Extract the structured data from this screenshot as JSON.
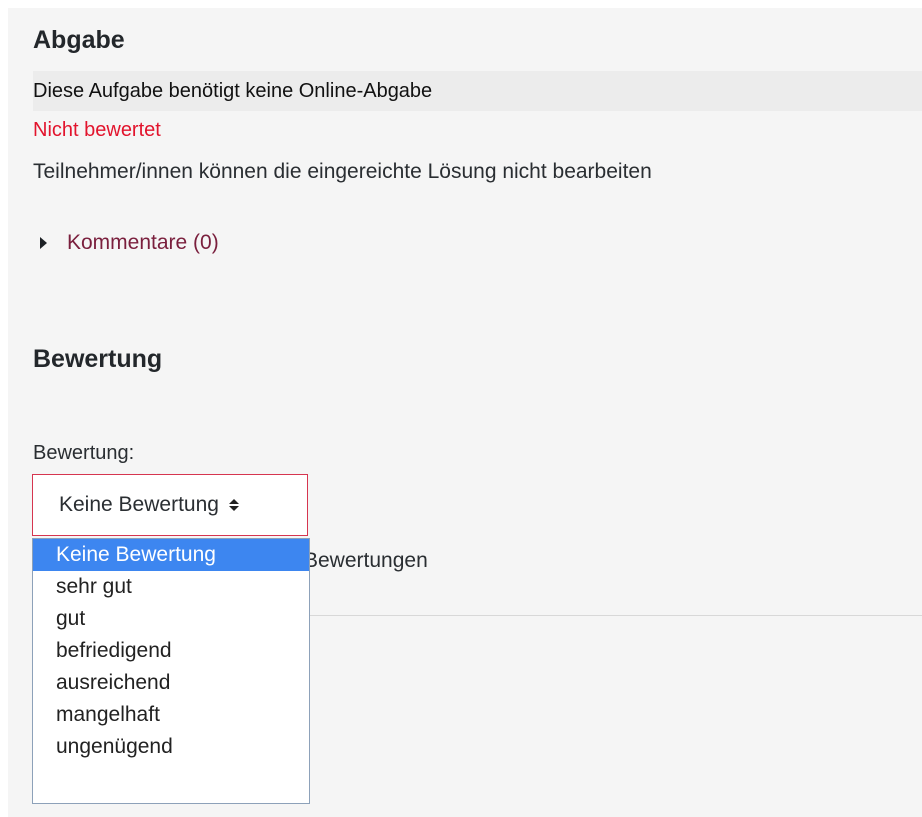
{
  "submission": {
    "heading": "Abgabe",
    "status_label": "Diese Aufgabe benötigt keine Online-Abgabe",
    "grading_status": "Nicht bewertet",
    "edit_status": "Teilnehmer/innen können die eingereichte Lösung nicht bearbeiten",
    "comments_link": "Kommentare (0)"
  },
  "grading": {
    "heading": "Bewertung",
    "field_label": "Bewertung:",
    "select_value": "Keine Bewertung",
    "obscured_text": "Bewertungen",
    "options": [
      "Keine Bewertung",
      "sehr gut",
      "gut",
      "befriedigend",
      "ausreichend",
      "mangelhaft",
      "ungenügend"
    ],
    "selected_index": 0
  },
  "colors": {
    "accent_red": "#e2142d",
    "link": "#7a1f3d",
    "selected_option": "#3d86f0"
  }
}
